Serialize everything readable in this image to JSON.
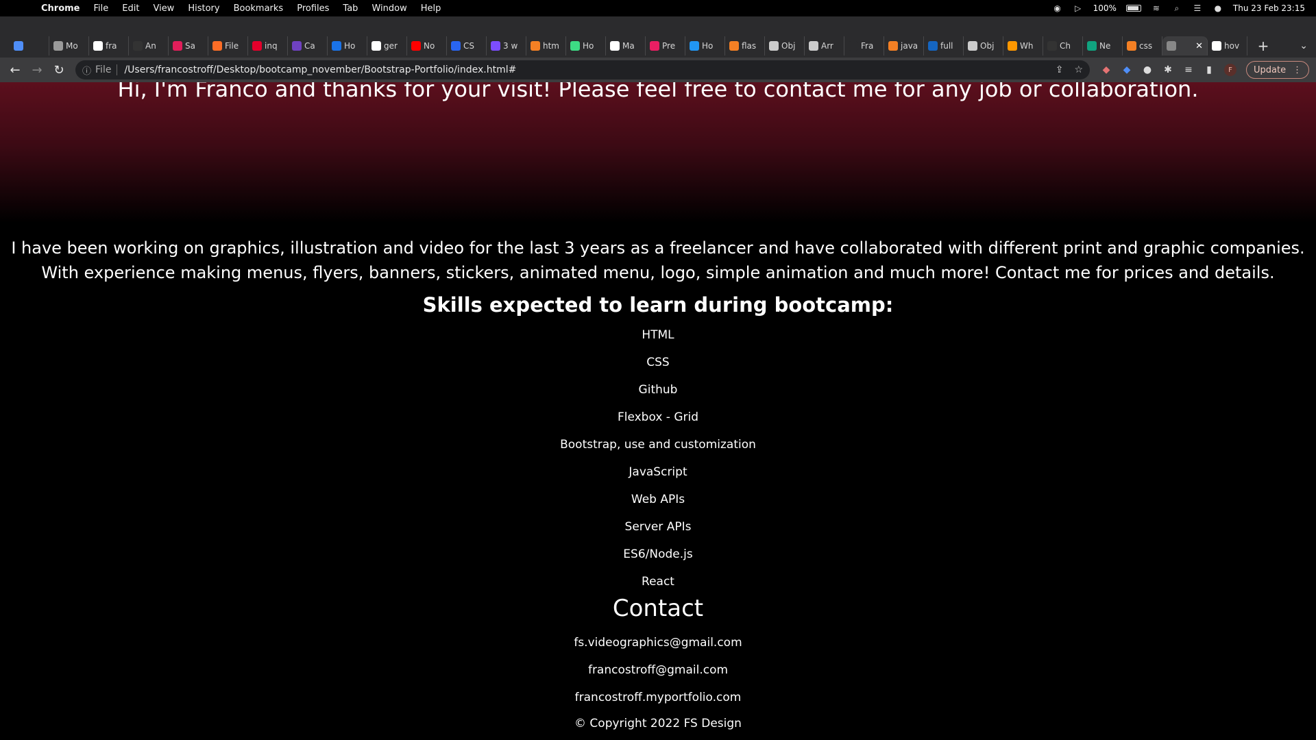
{
  "menubar": {
    "items": [
      "Chrome",
      "File",
      "Edit",
      "View",
      "History",
      "Bookmarks",
      "Profiles",
      "Tab",
      "Window",
      "Help"
    ],
    "battery": "100%",
    "datetime": "Thu 23 Feb  23:15"
  },
  "tabs": [
    {
      "label": "",
      "color": "#4f8ef7"
    },
    {
      "label": "Mo",
      "color": "#9a9a9a"
    },
    {
      "label": "fra",
      "color": "#ffffff"
    },
    {
      "label": "An",
      "color": "#333333"
    },
    {
      "label": "Sa",
      "color": "#e01e5a"
    },
    {
      "label": "File",
      "color": "#fc6d26"
    },
    {
      "label": "inq",
      "color": "#e4002b"
    },
    {
      "label": "Ca",
      "color": "#6f42c1"
    },
    {
      "label": "Ho",
      "color": "#1a73e8"
    },
    {
      "label": "ger",
      "color": "#ffffff"
    },
    {
      "label": "No",
      "color": "#ff0000"
    },
    {
      "label": "CS",
      "color": "#2965f1"
    },
    {
      "label": "3 w",
      "color": "#7c4dff"
    },
    {
      "label": "htm",
      "color": "#f48024"
    },
    {
      "label": "Ho",
      "color": "#3ddc84"
    },
    {
      "label": "Ma",
      "color": "#ffffff"
    },
    {
      "label": "Pre",
      "color": "#e91e63"
    },
    {
      "label": "Ho",
      "color": "#2196f3"
    },
    {
      "label": "flas",
      "color": "#f48024"
    },
    {
      "label": "Obj",
      "color": "#cccccc"
    },
    {
      "label": "Arr",
      "color": "#cccccc"
    },
    {
      "label": "Fra",
      "color": "#2b2b2d"
    },
    {
      "label": "java",
      "color": "#f48024"
    },
    {
      "label": "full",
      "color": "#1565c0"
    },
    {
      "label": "Obj",
      "color": "#cccccc"
    },
    {
      "label": "Wh",
      "color": "#ff9800"
    },
    {
      "label": "Ch",
      "color": "#333333"
    },
    {
      "label": "Ne",
      "color": "#10a37f"
    },
    {
      "label": "css",
      "color": "#f48024"
    },
    {
      "label": "",
      "color": "#888888",
      "active": true
    },
    {
      "label": "hov",
      "color": "#ffffff"
    }
  ],
  "toolbar": {
    "scheme": "File",
    "url": "/Users/francostroff/Desktop/bootcamp_november/Bootstrap-Portfolio/index.html#",
    "profile_initial": "F",
    "update_label": "Update"
  },
  "page": {
    "hero_text": "Hi, I'm Franco and thanks for your visit! Please feel free to contact me for any job or collaboration.",
    "intro_line1": "I have been working on graphics, illustration and video for the last 3 years as a freelancer and have collaborated with different print and graphic companies.",
    "intro_line2": "With experience making menus, flyers, banners, stickers, animated menu, logo, simple animation and much more! Contact me for prices and details.",
    "skills_title": "Skills expected to learn during bootcamp:",
    "skills": [
      "HTML",
      "CSS",
      "Github",
      "Flexbox - Grid",
      "Bootstrap, use and customization",
      "JavaScript",
      "Web APIs",
      "Server APIs",
      "ES6/Node.js",
      "React"
    ],
    "contact_title": "Contact",
    "contacts": [
      "fs.videographics@gmail.com",
      "francostroff@gmail.com",
      "francostroff.myportfolio.com"
    ],
    "copyright": "© Copyright 2022 FS Design"
  }
}
